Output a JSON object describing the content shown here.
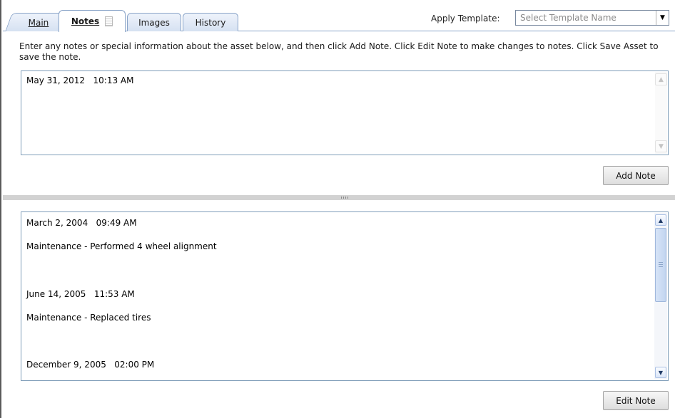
{
  "tabs": [
    {
      "label": "Main",
      "active": false
    },
    {
      "label": "Notes",
      "active": true
    },
    {
      "label": "Images",
      "active": false
    },
    {
      "label": "History",
      "active": false
    }
  ],
  "template": {
    "label": "Apply Template:",
    "placeholder": "Select Template Name"
  },
  "instructions": "Enter any notes or special information about the asset below, and then click Add Note. Click Edit Note to make changes to notes. Click Save Asset to save the note.",
  "note_input": {
    "value": "May 31, 2012   10:13 AM"
  },
  "buttons": {
    "add_note": "Add Note",
    "edit_note": "Edit Note"
  },
  "notes": [
    {
      "timestamp": "March 2, 2004   09:49 AM",
      "text": "Maintenance - Performed 4 wheel alignment"
    },
    {
      "timestamp": "June 14, 2005   11:53 AM",
      "text": "Maintenance - Replaced tires"
    },
    {
      "timestamp": "December 9, 2005   02:00 PM",
      "text": ""
    }
  ],
  "colors": {
    "tab_border": "#8aa4c8",
    "field_border": "#7f9db9"
  }
}
